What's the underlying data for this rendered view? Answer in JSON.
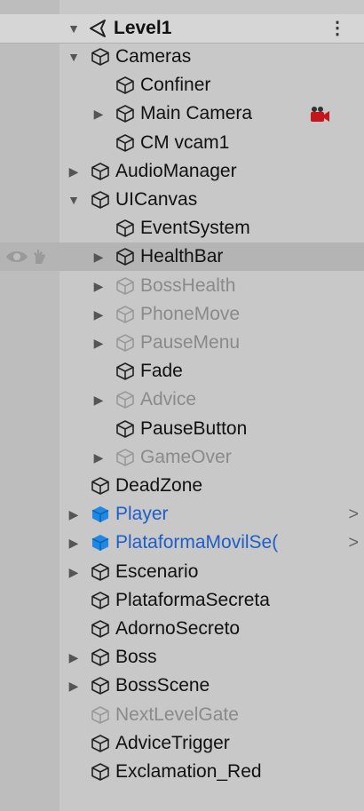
{
  "scene": {
    "name": "Level1",
    "menu_icon": "kebab-menu-icon",
    "scene_icon": "unity-scene-icon"
  },
  "colors": {
    "panel_bg": "#c8c8c8",
    "gutter_bg": "#bdbdbd",
    "highlight_row": "#b4b4b4",
    "text": "#111111",
    "inactive_text": "#8a8a8a",
    "prefab_text": "#1f5dc7",
    "prefab_cube": "#1e88e5"
  },
  "hierarchy": [
    {
      "label": "Cameras",
      "depth": 1,
      "fold": "expanded",
      "state": "normal"
    },
    {
      "label": "Confiner",
      "depth": 2,
      "fold": "none",
      "state": "normal"
    },
    {
      "label": "Main Camera",
      "depth": 2,
      "fold": "collapsed",
      "state": "normal",
      "badge": "camera-gizmo-icon"
    },
    {
      "label": "CM vcam1",
      "depth": 2,
      "fold": "none",
      "state": "normal"
    },
    {
      "label": "AudioManager",
      "depth": 1,
      "fold": "collapsed",
      "state": "normal"
    },
    {
      "label": "UICanvas",
      "depth": 1,
      "fold": "expanded",
      "state": "normal"
    },
    {
      "label": "EventSystem",
      "depth": 2,
      "fold": "none",
      "state": "normal"
    },
    {
      "label": "HealthBar",
      "depth": 2,
      "fold": "collapsed",
      "state": "normal",
      "hover": true
    },
    {
      "label": "BossHealth",
      "depth": 2,
      "fold": "collapsed",
      "state": "inactive"
    },
    {
      "label": "PhoneMove",
      "depth": 2,
      "fold": "collapsed",
      "state": "inactive"
    },
    {
      "label": "PauseMenu",
      "depth": 2,
      "fold": "collapsed",
      "state": "inactive"
    },
    {
      "label": "Fade",
      "depth": 2,
      "fold": "none",
      "state": "normal"
    },
    {
      "label": "Advice",
      "depth": 2,
      "fold": "collapsed",
      "state": "inactive"
    },
    {
      "label": "PauseButton",
      "depth": 2,
      "fold": "none",
      "state": "normal"
    },
    {
      "label": "GameOver",
      "depth": 2,
      "fold": "collapsed",
      "state": "inactive"
    },
    {
      "label": "DeadZone",
      "depth": 1,
      "fold": "none",
      "state": "normal"
    },
    {
      "label": "Player",
      "depth": 1,
      "fold": "collapsed",
      "state": "prefab",
      "chevron": ">"
    },
    {
      "label": "PlataformaMovilSe(",
      "depth": 1,
      "fold": "collapsed",
      "state": "prefab",
      "chevron": ">"
    },
    {
      "label": "Escenario",
      "depth": 1,
      "fold": "collapsed",
      "state": "normal"
    },
    {
      "label": "PlataformaSecreta",
      "depth": 1,
      "fold": "none",
      "state": "normal"
    },
    {
      "label": "AdornoSecreto",
      "depth": 1,
      "fold": "none",
      "state": "normal"
    },
    {
      "label": "Boss",
      "depth": 1,
      "fold": "collapsed",
      "state": "normal"
    },
    {
      "label": "BossScene",
      "depth": 1,
      "fold": "collapsed",
      "state": "normal"
    },
    {
      "label": "NextLevelGate",
      "depth": 1,
      "fold": "none",
      "state": "inactive"
    },
    {
      "label": "AdviceTrigger",
      "depth": 1,
      "fold": "none",
      "state": "normal"
    },
    {
      "label": "Exclamation_Red",
      "depth": 1,
      "fold": "none",
      "state": "normal"
    }
  ],
  "hover_icons": {
    "visibility": "eye-icon",
    "pickability": "hand-icon"
  }
}
